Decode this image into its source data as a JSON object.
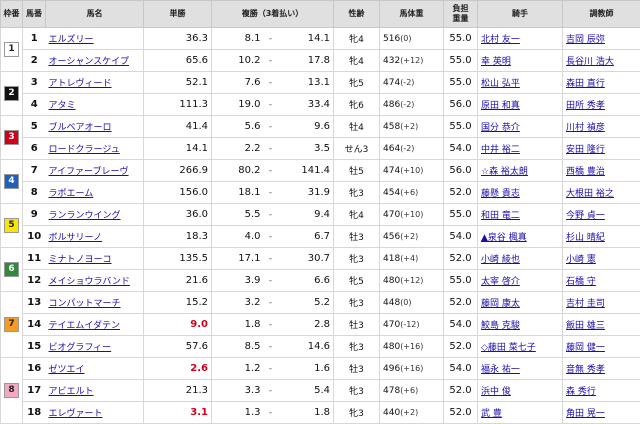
{
  "headers": {
    "waku": "枠番",
    "uma": "馬番",
    "name": "馬名",
    "odds": "単勝",
    "place": "複勝（3着払い）",
    "sexage": "性齢",
    "weight": "馬体重",
    "kinryo": "負担\n重量",
    "jockey": "騎手",
    "trainer": "調教師"
  },
  "waku_colors": {
    "1": {
      "bg": "#ffffff",
      "fg": "#222222"
    },
    "2": {
      "bg": "#111111",
      "fg": "#ffffff"
    },
    "3": {
      "bg": "#d0021b",
      "fg": "#ffffff"
    },
    "4": {
      "bg": "#1f5fbf",
      "fg": "#ffffff"
    },
    "5": {
      "bg": "#f6e600",
      "fg": "#222222"
    },
    "6": {
      "bg": "#2f8a3a",
      "fg": "#ffffff"
    },
    "7": {
      "bg": "#f59a23",
      "fg": "#222222"
    },
    "8": {
      "bg": "#f4a9c1",
      "fg": "#222222"
    }
  },
  "waku_groups": [
    {
      "waku": "1",
      "rows": 2
    },
    {
      "waku": "2",
      "rows": 2
    },
    {
      "waku": "3",
      "rows": 2
    },
    {
      "waku": "4",
      "rows": 2
    },
    {
      "waku": "5",
      "rows": 2
    },
    {
      "waku": "6",
      "rows": 2
    },
    {
      "waku": "7",
      "rows": 3
    },
    {
      "waku": "8",
      "rows": 3
    }
  ],
  "rows": [
    {
      "uma": "1",
      "name": "エルズリー",
      "odds": "36.3",
      "pmin": "8.1",
      "pmax": "14.1",
      "sexage": "牝4",
      "weight": "516",
      "wdiff": "(0)",
      "kinryo": "55.0",
      "jockey": "北村 友一",
      "trainer": "吉岡 辰弥"
    },
    {
      "uma": "2",
      "name": "オーシャンスケイプ",
      "odds": "65.6",
      "pmin": "10.2",
      "pmax": "17.8",
      "sexage": "牝4",
      "weight": "432",
      "wdiff": "(+12)",
      "kinryo": "55.0",
      "jockey": "幸 英明",
      "trainer": "長谷川 浩大"
    },
    {
      "uma": "3",
      "name": "アトレヴィード",
      "odds": "52.1",
      "pmin": "7.6",
      "pmax": "13.1",
      "sexage": "牝5",
      "weight": "474",
      "wdiff": "(-2)",
      "kinryo": "55.0",
      "jockey": "松山 弘平",
      "trainer": "森田 直行"
    },
    {
      "uma": "4",
      "name": "アタミ",
      "odds": "111.3",
      "pmin": "19.0",
      "pmax": "33.4",
      "sexage": "牝6",
      "weight": "486",
      "wdiff": "(-2)",
      "kinryo": "56.0",
      "jockey": "原田 和真",
      "trainer": "田所 秀孝"
    },
    {
      "uma": "5",
      "name": "ブルベアオーロ",
      "odds": "41.4",
      "pmin": "5.6",
      "pmax": "9.6",
      "sexage": "牡4",
      "weight": "458",
      "wdiff": "(+2)",
      "kinryo": "55.0",
      "jockey": "国分 恭介",
      "trainer": "川村 禎彦"
    },
    {
      "uma": "6",
      "name": "ロードクラージュ",
      "odds": "14.1",
      "pmin": "2.2",
      "pmax": "3.5",
      "sexage": "せん3",
      "weight": "464",
      "wdiff": "(-2)",
      "kinryo": "54.0",
      "jockey": "中井 裕二",
      "trainer": "安田 隆行"
    },
    {
      "uma": "7",
      "name": "アイファーブレーヴ",
      "odds": "266.9",
      "pmin": "80.2",
      "pmax": "141.4",
      "sexage": "牡5",
      "weight": "474",
      "wdiff": "(+10)",
      "kinryo": "56.0",
      "jockey": "☆森 裕太朗",
      "trainer": "西橋 豊治"
    },
    {
      "uma": "8",
      "name": "ラポエーム",
      "odds": "156.0",
      "pmin": "18.1",
      "pmax": "31.9",
      "sexage": "牝3",
      "weight": "454",
      "wdiff": "(+6)",
      "kinryo": "52.0",
      "jockey": "藤懸 貴志",
      "trainer": "大根田 裕之"
    },
    {
      "uma": "9",
      "name": "ランランウイング",
      "odds": "36.0",
      "pmin": "5.5",
      "pmax": "9.4",
      "sexage": "牝4",
      "weight": "470",
      "wdiff": "(+10)",
      "kinryo": "55.0",
      "jockey": "和田 竜二",
      "trainer": "今野 貞一"
    },
    {
      "uma": "10",
      "name": "ボルサリーノ",
      "odds": "18.3",
      "pmin": "4.0",
      "pmax": "6.7",
      "sexage": "牡3",
      "weight": "456",
      "wdiff": "(+2)",
      "kinryo": "54.0",
      "jockey": "▲泉谷 楓真",
      "trainer": "杉山 晴紀"
    },
    {
      "uma": "11",
      "name": "ミナトノヨーコ",
      "odds": "135.5",
      "pmin": "17.1",
      "pmax": "30.7",
      "sexage": "牝3",
      "weight": "418",
      "wdiff": "(+4)",
      "kinryo": "52.0",
      "jockey": "小崎 綾也",
      "trainer": "小崎 憲"
    },
    {
      "uma": "12",
      "name": "メイショウラバンド",
      "odds": "21.6",
      "pmin": "3.9",
      "pmax": "6.6",
      "sexage": "牝5",
      "weight": "480",
      "wdiff": "(+12)",
      "kinryo": "55.0",
      "jockey": "太宰 啓介",
      "trainer": "石橋 守"
    },
    {
      "uma": "13",
      "name": "コンパットマーチ",
      "odds": "15.2",
      "pmin": "3.2",
      "pmax": "5.2",
      "sexage": "牝3",
      "weight": "448",
      "wdiff": "(0)",
      "kinryo": "52.0",
      "jockey": "藤岡 康太",
      "trainer": "吉村 圭司"
    },
    {
      "uma": "14",
      "name": "テイエムイダテン",
      "odds": "9.0",
      "hot": true,
      "pmin": "1.8",
      "pmax": "2.8",
      "sexage": "牡3",
      "weight": "470",
      "wdiff": "(-12)",
      "kinryo": "54.0",
      "jockey": "鮫島 克駿",
      "trainer": "飯田 雄三"
    },
    {
      "uma": "15",
      "name": "ビオグラフィー",
      "odds": "57.6",
      "pmin": "8.5",
      "pmax": "14.6",
      "sexage": "牝3",
      "weight": "480",
      "wdiff": "(+16)",
      "kinryo": "52.0",
      "jockey": "◇藤田 菜七子",
      "trainer": "藤岡 健一"
    },
    {
      "uma": "16",
      "name": "ゼツエイ",
      "odds": "2.6",
      "hot": true,
      "pmin": "1.2",
      "pmax": "1.6",
      "sexage": "牡3",
      "weight": "496",
      "wdiff": "(+16)",
      "kinryo": "54.0",
      "jockey": "福永 祐一",
      "trainer": "音無 秀孝"
    },
    {
      "uma": "17",
      "name": "アビエルト",
      "odds": "21.3",
      "pmin": "3.3",
      "pmax": "5.4",
      "sexage": "牝3",
      "weight": "478",
      "wdiff": "(+6)",
      "kinryo": "52.0",
      "jockey": "浜中 俊",
      "trainer": "森 秀行"
    },
    {
      "uma": "18",
      "name": "エレヴァート",
      "odds": "3.1",
      "hot": true,
      "pmin": "1.3",
      "pmax": "1.8",
      "sexage": "牝3",
      "weight": "440",
      "wdiff": "(+2)",
      "kinryo": "52.0",
      "jockey": "武 豊",
      "trainer": "角田 晃一"
    }
  ]
}
